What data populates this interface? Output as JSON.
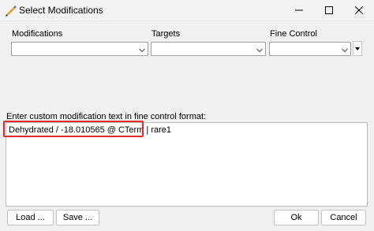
{
  "window": {
    "title": "Select Modifications",
    "app_icon": "pencil-app-icon",
    "controls": [
      "minimize-icon",
      "maximize-icon",
      "close-icon"
    ]
  },
  "selectors": {
    "modifications_label": "Modifications",
    "modifications_value": "",
    "targets_label": "Targets",
    "targets_value": "",
    "fine_control_label": "Fine Control",
    "fine_control_value": ""
  },
  "custom": {
    "label": "Enter custom modification text in fine control format:",
    "text": "Dehydrated / -18.010565 @ CTerm | rare1"
  },
  "buttons": {
    "load": "Load ...",
    "save": "Save ...",
    "ok": "Ok",
    "cancel": "Cancel"
  },
  "colors": {
    "highlight": "#e0282e",
    "window_bg": "#f0f0f0"
  }
}
